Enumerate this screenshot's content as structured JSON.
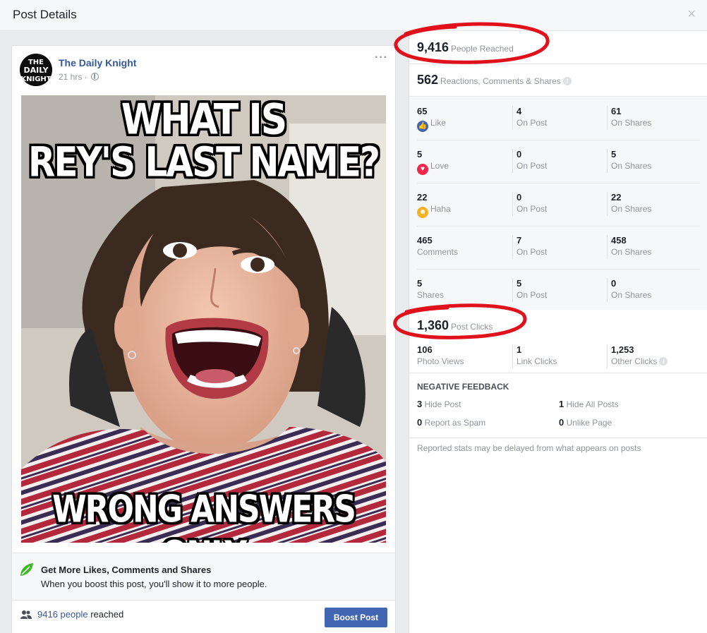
{
  "header": {
    "title": "Post Details",
    "close_glyph": "×"
  },
  "post": {
    "avatar_text": "THE DAILY KNIGHT",
    "page_name": "The Daily Knight",
    "time": "21 hrs ·",
    "more_glyph": "···",
    "meme_top_line1": "WHAT IS",
    "meme_top_line2": "REY'S LAST NAME?",
    "meme_bottom": "WRONG ANSWERS ONLY"
  },
  "boost": {
    "title": "Get More Likes, Comments and Shares",
    "subtitle": "When you boost this post, you'll show it to more people.",
    "reach_link": "9416 people",
    "reach_suffix": " reached",
    "button": "Boost Post"
  },
  "stats": {
    "people_reached": "9,416",
    "people_reached_label": "People Reached",
    "reactions_total": "562",
    "reactions_label": "Reactions, Comments & Shares",
    "rows": [
      {
        "icon": "like-icon",
        "total": "65",
        "label": "Like",
        "on_post": "4",
        "on_post_label": "On Post",
        "on_shares": "61",
        "on_shares_label": "On Shares"
      },
      {
        "icon": "love-icon",
        "total": "5",
        "label": "Love",
        "on_post": "0",
        "on_post_label": "On Post",
        "on_shares": "5",
        "on_shares_label": "On Shares"
      },
      {
        "icon": "haha-icon",
        "total": "22",
        "label": "Haha",
        "on_post": "0",
        "on_post_label": "On Post",
        "on_shares": "22",
        "on_shares_label": "On Shares"
      },
      {
        "icon": "",
        "total": "465",
        "label": "Comments",
        "on_post": "7",
        "on_post_label": "On Post",
        "on_shares": "458",
        "on_shares_label": "On Shares"
      },
      {
        "icon": "",
        "total": "5",
        "label": "Shares",
        "on_post": "5",
        "on_post_label": "On Post",
        "on_shares": "0",
        "on_shares_label": "On Shares"
      }
    ],
    "post_clicks": "1,360",
    "post_clicks_label": "Post Clicks",
    "clicks": [
      {
        "value": "106",
        "label": "Photo Views"
      },
      {
        "value": "1",
        "label": "Link Clicks"
      },
      {
        "value": "1,253",
        "label": "Other Clicks"
      }
    ],
    "negative_title": "NEGATIVE FEEDBACK",
    "negative": [
      {
        "value": "3",
        "label": "Hide Post"
      },
      {
        "value": "1",
        "label": "Hide All Posts"
      },
      {
        "value": "0",
        "label": "Report as Spam"
      },
      {
        "value": "0",
        "label": "Unlike Page"
      }
    ],
    "note": "Reported stats may be delayed from what appears on posts"
  },
  "colors": {
    "accent": "#4267b2",
    "link": "#365899",
    "annotation": "#e0111b",
    "like": "#4267b2",
    "love": "#f0284a",
    "haha": "#f7b125"
  }
}
